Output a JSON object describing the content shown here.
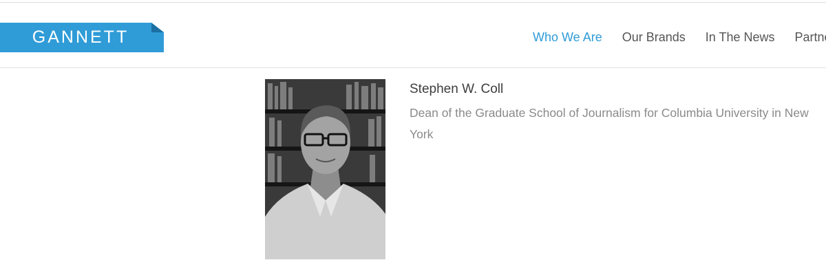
{
  "header": {
    "logo_text": "GANNETT",
    "brand_color": "#2f9cd7",
    "nav": [
      {
        "label": "Who We Are",
        "active": true
      },
      {
        "label": "Our Brands",
        "active": false
      },
      {
        "label": "In The News",
        "active": false
      },
      {
        "label": "Partne",
        "active": false
      }
    ]
  },
  "profile": {
    "photo": "portrait-photo",
    "name": "Stephen W. Coll",
    "title": "Dean of the Graduate School of Journalism for Columbia University in New York"
  }
}
